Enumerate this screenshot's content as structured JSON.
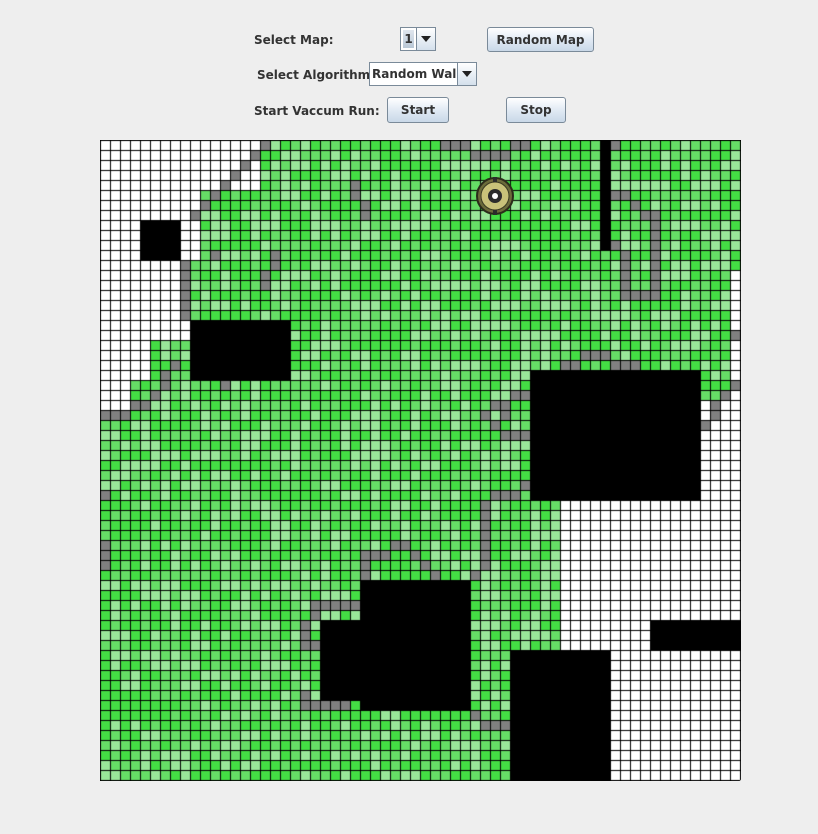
{
  "controls": {
    "select_map_label": "Select Map:",
    "map_value": "1",
    "random_map_button": "Random Map",
    "select_algorithm_label": "Select Algorithm:",
    "algorithm_value": "Random Walk",
    "start_run_label": "Start Vaccum Run:",
    "start_button": "Start",
    "stop_button": "Stop"
  },
  "grid": {
    "cols": 64,
    "rows": 64,
    "colors": {
      "clean": "#ffffff",
      "gridline": "#000000",
      "obstacle": "#000000",
      "wall": "#808080",
      "visited_light": "#99e699",
      "visited_mid": "#66dd66",
      "visited_dark": "#44dd44"
    },
    "obstacles": [
      [
        4,
        8,
        7,
        11
      ],
      [
        9,
        18,
        18,
        23
      ],
      [
        43,
        23,
        59,
        35
      ],
      [
        57,
        28,
        59,
        35
      ],
      [
        26,
        44,
        36,
        56
      ],
      [
        22,
        48,
        25,
        55
      ],
      [
        41,
        51,
        50,
        63
      ],
      [
        55,
        48,
        63,
        50
      ],
      [
        50,
        0,
        50,
        10
      ]
    ],
    "walls": [
      [
        16,
        0
      ],
      [
        15,
        1
      ],
      [
        14,
        2
      ],
      [
        13,
        3
      ],
      [
        12,
        4
      ],
      [
        11,
        5
      ],
      [
        10,
        6
      ],
      [
        9,
        7
      ],
      [
        11,
        11
      ],
      [
        8,
        12
      ],
      [
        8,
        13
      ],
      [
        8,
        14
      ],
      [
        8,
        15
      ],
      [
        8,
        16
      ],
      [
        8,
        17
      ],
      [
        7,
        22
      ],
      [
        6,
        23
      ],
      [
        6,
        24
      ],
      [
        5,
        25
      ],
      [
        4,
        26
      ],
      [
        3,
        26
      ],
      [
        2,
        27
      ],
      [
        1,
        27
      ],
      [
        0,
        27
      ],
      [
        11,
        23
      ],
      [
        12,
        23
      ],
      [
        13,
        23
      ],
      [
        12,
        24
      ],
      [
        17,
        11
      ],
      [
        17,
        12
      ],
      [
        16,
        13
      ],
      [
        16,
        14
      ],
      [
        25,
        4
      ],
      [
        25,
        5
      ],
      [
        26,
        6
      ],
      [
        26,
        7
      ],
      [
        34,
        0
      ],
      [
        35,
        0
      ],
      [
        36,
        0
      ],
      [
        37,
        1
      ],
      [
        38,
        1
      ],
      [
        39,
        1
      ],
      [
        40,
        1
      ],
      [
        41,
        0
      ],
      [
        42,
        0
      ],
      [
        51,
        0
      ],
      [
        51,
        5
      ],
      [
        52,
        5
      ],
      [
        53,
        6
      ],
      [
        54,
        7
      ],
      [
        55,
        7
      ],
      [
        55,
        8
      ],
      [
        55,
        9
      ],
      [
        55,
        10
      ],
      [
        55,
        11
      ],
      [
        55,
        12
      ],
      [
        55,
        13
      ],
      [
        55,
        14
      ],
      [
        55,
        15
      ],
      [
        54,
        15
      ],
      [
        53,
        15
      ],
      [
        52,
        15
      ],
      [
        51,
        10
      ],
      [
        52,
        11
      ],
      [
        52,
        12
      ],
      [
        52,
        13
      ],
      [
        52,
        14
      ],
      [
        46,
        22
      ],
      [
        47,
        22
      ],
      [
        48,
        21
      ],
      [
        49,
        21
      ],
      [
        50,
        21
      ],
      [
        51,
        22
      ],
      [
        52,
        22
      ],
      [
        53,
        22
      ],
      [
        63,
        19
      ],
      [
        63,
        24
      ],
      [
        62,
        25
      ],
      [
        61,
        26
      ],
      [
        61,
        27
      ],
      [
        60,
        28
      ],
      [
        42,
        25
      ],
      [
        41,
        25
      ],
      [
        40,
        26
      ],
      [
        39,
        26
      ],
      [
        40,
        27
      ],
      [
        38,
        27
      ],
      [
        39,
        28
      ],
      [
        40,
        29
      ],
      [
        41,
        29
      ],
      [
        42,
        29
      ],
      [
        38,
        36
      ],
      [
        39,
        35
      ],
      [
        40,
        35
      ],
      [
        41,
        35
      ],
      [
        42,
        34
      ],
      [
        38,
        37
      ],
      [
        38,
        38
      ],
      [
        38,
        39
      ],
      [
        38,
        40
      ],
      [
        38,
        41
      ],
      [
        38,
        42
      ],
      [
        37,
        43
      ],
      [
        0,
        35
      ],
      [
        0,
        40
      ],
      [
        0,
        41
      ],
      [
        0,
        42
      ],
      [
        26,
        41
      ],
      [
        27,
        41
      ],
      [
        28,
        41
      ],
      [
        29,
        40
      ],
      [
        30,
        40
      ],
      [
        31,
        41
      ],
      [
        32,
        42
      ],
      [
        33,
        43
      ],
      [
        26,
        42
      ],
      [
        26,
        43
      ],
      [
        21,
        46
      ],
      [
        22,
        46
      ],
      [
        23,
        46
      ],
      [
        24,
        46
      ],
      [
        25,
        46
      ],
      [
        21,
        47
      ],
      [
        20,
        48
      ],
      [
        20,
        49
      ],
      [
        20,
        50
      ],
      [
        21,
        50
      ],
      [
        20,
        55
      ],
      [
        20,
        56
      ],
      [
        21,
        56
      ],
      [
        22,
        56
      ],
      [
        23,
        56
      ],
      [
        24,
        56
      ],
      [
        37,
        57
      ],
      [
        38,
        58
      ],
      [
        39,
        58
      ],
      [
        40,
        58
      ]
    ],
    "robot": [
      39,
      5
    ]
  },
  "icons": {
    "robot": "robot-vacuum-icon",
    "dropdown": "chevron-down-icon"
  }
}
